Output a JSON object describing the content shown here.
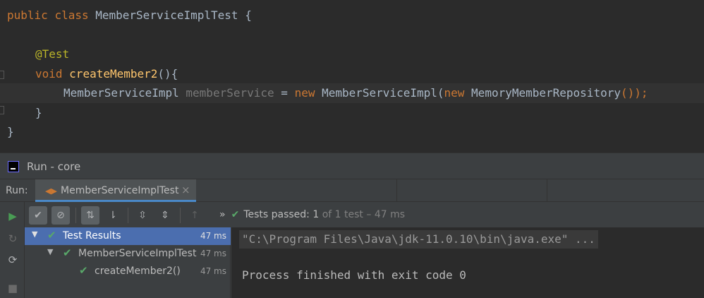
{
  "editor": {
    "line1": {
      "kw1": "public",
      "kw2": "class",
      "name": "MemberServiceImplTest",
      "brace": "{"
    },
    "line2": {
      "annotation": "@Test"
    },
    "line3": {
      "kw": "void",
      "method": "createMember2",
      "rest": "(){"
    },
    "line4": {
      "type": "MemberServiceImpl",
      "var": "memberService",
      "eq": "=",
      "kw_new1": "new",
      "ctor": "MemberServiceImpl(",
      "kw_new2": "new",
      "arg": "MemoryMemberRepository",
      "end": "());"
    },
    "line5": {
      "brace": "}"
    },
    "line6": {
      "brace": "}"
    }
  },
  "run_window": {
    "title": "Run - core",
    "run_label": "Run:",
    "tab": {
      "label": "MemberServiceImplTest",
      "close": "×"
    }
  },
  "status": {
    "prefix": "Tests passed:",
    "passed": "1",
    "of_text": "of 1 test – 47 ms"
  },
  "tree": [
    {
      "label": "Test Results",
      "time": "47 ms",
      "selected": true
    },
    {
      "label": "MemberServiceImplTest",
      "time": "47 ms"
    },
    {
      "label": "createMember2()",
      "time": "47 ms"
    }
  ],
  "console": {
    "command": "\"C:\\Program Files\\Java\\jdk-11.0.10\\bin\\java.exe\" ...",
    "exit_message": "Process finished with exit code 0"
  },
  "icons": {
    "run": "play-icon",
    "rerun_failed": "rerun-failed-icon",
    "toggle_autotest": "toggle-auto-test-icon",
    "stop": "stop-icon",
    "show_passed": "check-icon",
    "show_ignored": "ignored-icon",
    "sort_alpha": "sort-alphabetically-icon",
    "sort_duration": "sort-by-duration-icon",
    "expand_all": "expand-all-icon",
    "collapse_all": "collapse-all-icon",
    "prev_failed": "up-arrow-icon"
  },
  "colors": {
    "keyword": "#cc7832",
    "annotation": "#bbb529",
    "method": "#ffc66d",
    "pass": "#59a869",
    "selection": "#4b6eaf"
  }
}
